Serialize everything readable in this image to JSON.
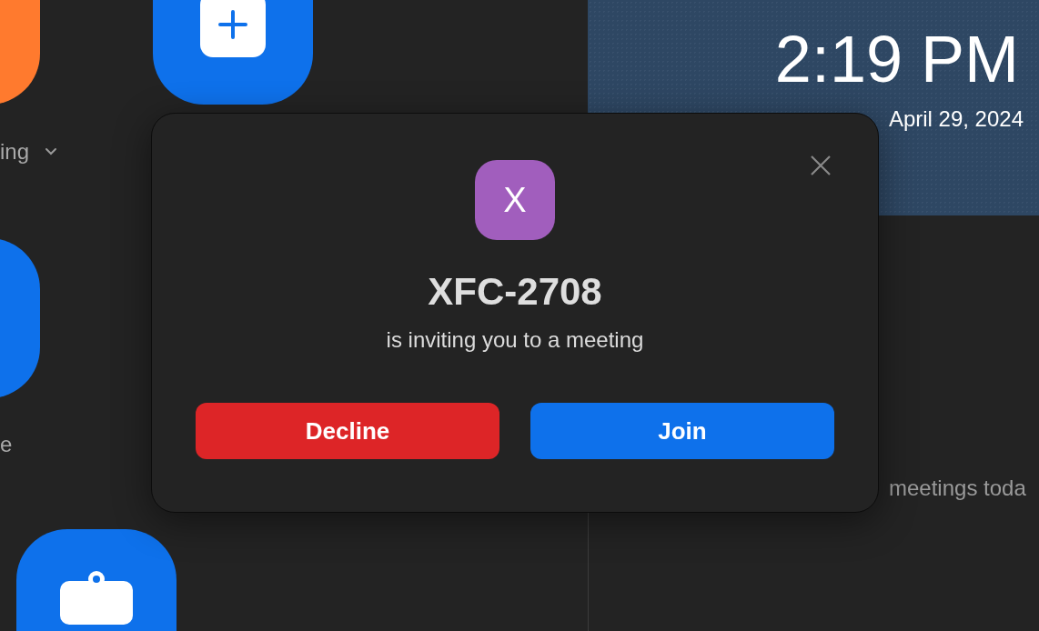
{
  "home": {
    "tiles": [
      {
        "kind": "plain",
        "color": "#ff7a2e"
      },
      {
        "kind": "plus",
        "color": "#0e71eb"
      },
      {
        "kind": "plain",
        "color": "#0e71eb"
      },
      {
        "kind": "clipboard",
        "color": "#0e71eb"
      }
    ],
    "labels": [
      {
        "text": "ing",
        "has_menu": true
      },
      {
        "text": "e",
        "has_menu": false
      }
    ]
  },
  "panel": {
    "clock": "2:19 PM",
    "date": "April 29, 2024",
    "agenda_text": "meetings toda"
  },
  "invite": {
    "avatar": {
      "letter": "X",
      "color": "#a15ebd"
    },
    "caller": "XFC-2708",
    "message": "is inviting you to a meeting",
    "buttons": [
      {
        "kind": "decline",
        "label": "Decline"
      },
      {
        "kind": "join",
        "label": "Join"
      }
    ]
  }
}
